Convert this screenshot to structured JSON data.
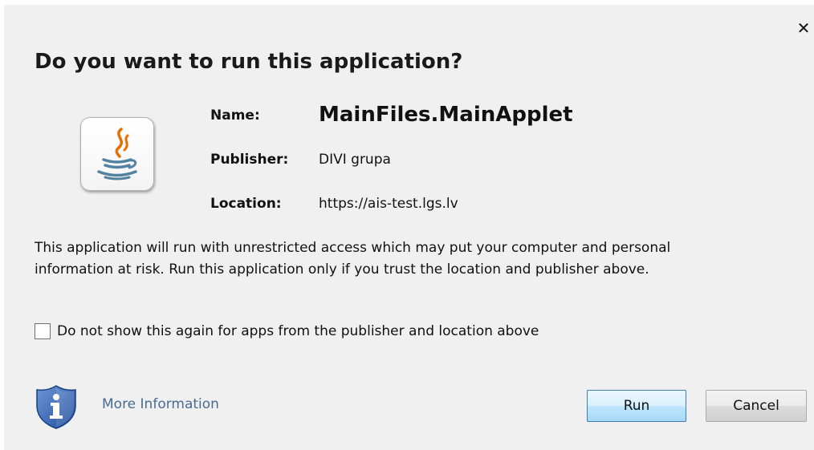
{
  "dialog": {
    "title": "Do you want to run this application?",
    "close_icon": "close-icon",
    "app_icon": "java-icon"
  },
  "info": {
    "name_label": "Name:",
    "name_value": "MainFiles.MainApplet",
    "publisher_label": "Publisher:",
    "publisher_value": "DIVI grupa",
    "location_label": "Location:",
    "location_value": "https://ais-test.lgs.lv"
  },
  "warning": {
    "line1": "This application will run with unrestricted access which may put your computer and personal",
    "line2": "information at risk. Run this application only if you trust the location and publisher above."
  },
  "checkbox": {
    "label": "Do not show this again for apps from the publisher and location above",
    "checked": false
  },
  "footer": {
    "more_info_icon": "shield-info-icon",
    "more_info_label": "More Information",
    "run_label": "Run",
    "cancel_label": "Cancel"
  },
  "colors": {
    "dialog_bg": "#f0f0f0",
    "link": "#4a6b8f",
    "run_border": "#3c7fb1",
    "shield_blue": "#2f5fb0"
  }
}
